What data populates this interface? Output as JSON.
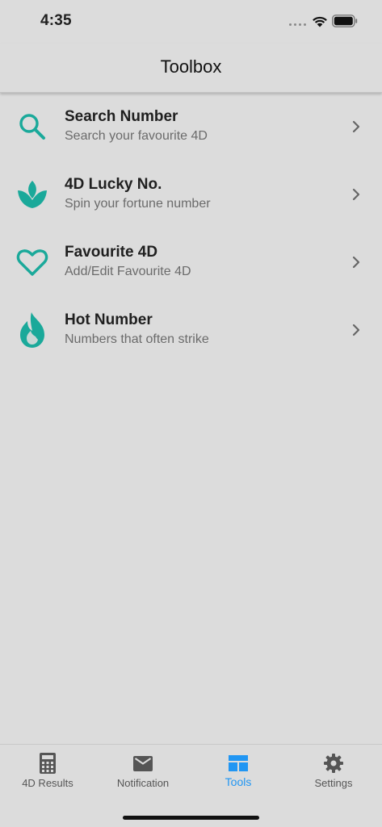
{
  "status_bar": {
    "time": "4:35"
  },
  "header": {
    "title": "Toolbox"
  },
  "colors": {
    "accent": "#1aa99a",
    "active_tab": "#2196f3"
  },
  "tools": [
    {
      "title": "Search Number",
      "subtitle": "Search your favourite 4D",
      "icon": "search-icon"
    },
    {
      "title": "4D Lucky No.",
      "subtitle": "Spin your fortune number",
      "icon": "lotus-icon"
    },
    {
      "title": "Favourite 4D",
      "subtitle": "Add/Edit Favourite 4D",
      "icon": "heart-icon"
    },
    {
      "title": "Hot Number",
      "subtitle": "Numbers that often strike",
      "icon": "flame-icon"
    }
  ],
  "tab_bar": {
    "tabs": [
      {
        "label": "4D Results",
        "icon": "calculator-icon"
      },
      {
        "label": "Notification",
        "icon": "mail-icon"
      },
      {
        "label": "Tools",
        "icon": "tools-icon",
        "active": true
      },
      {
        "label": "Settings",
        "icon": "gear-icon"
      }
    ]
  }
}
